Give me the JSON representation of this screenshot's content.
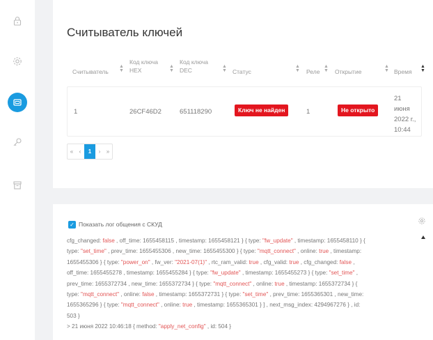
{
  "sidebar": {
    "items": [
      {
        "icon": "lock-icon",
        "active": false
      },
      {
        "icon": "gear-icon",
        "active": false
      },
      {
        "icon": "card-reader-icon",
        "active": true
      },
      {
        "icon": "key-icon",
        "active": false
      },
      {
        "icon": "archive-icon",
        "active": false
      }
    ]
  },
  "page": {
    "title": "Считыватель ключей"
  },
  "table": {
    "columns": [
      "Считыватель",
      "Код ключа HEX",
      "Код ключа DEC",
      "Статус",
      "Реле",
      "Открытие",
      "Время"
    ],
    "row": {
      "reader": "1",
      "hex": "26CF46D2",
      "dec": "651118290",
      "status": "Ключ не найден",
      "relay": "1",
      "open": "Не открыто",
      "time": "21 июня 2022 г., 10:44"
    }
  },
  "pagination": {
    "first": "«",
    "prev": "‹",
    "current": "1",
    "next": "›",
    "last": "»"
  },
  "log": {
    "checkbox_label": "Показать лог общения с СКУД",
    "checked": true,
    "lines": [
      "cfg_changed: false , off_time: 1655458115 , timestamp: 1655458121 } { type: \"fw_update\" , timestamp: 1655458110 } {",
      "type: \"set_time\" , prev_time: 1655455306 , new_time: 1655455300 } { type: \"mqtt_connect\" , online: true , timestamp:",
      "1655455306 } { type: \"power_on\" , fw_ver: \"2021-07(1)\" , rtc_ram_valid: true , cfg_valid: true , cfg_changed: false ,",
      "off_time: 1655455278 , timestamp: 1655455284 } { type: \"fw_update\" , timestamp: 1655455273 } { type: \"set_time\" ,",
      "prev_time: 1655372734 , new_time: 1655372734 } { type: \"mqtt_connect\" , online: true , timestamp: 1655372734 } {",
      "type: \"mqtt_connect\" , online: false , timestamp: 1655372731 } { type: \"set_time\" , prev_time: 1655365301 , new_time:",
      "1655365296 } { type: \"mqtt_connect\" , online: true , timestamp: 1655365301 } ] , next_msg_index: 4294967276 } , id:",
      "503 }",
      "> 21 июня 2022 10:46:18 { method: \"apply_net_config\" , id: 504 }"
    ]
  },
  "colors": {
    "accent": "#1a9be0",
    "danger": "#e3161f"
  }
}
